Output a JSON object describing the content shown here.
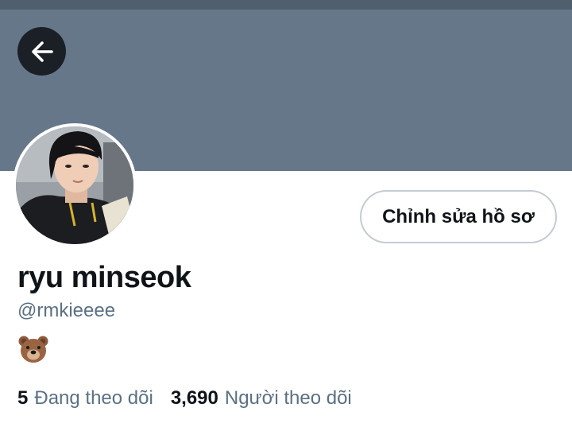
{
  "profile": {
    "edit_button_label": "Chỉnh sửa hồ sơ",
    "display_name": "ryu minseok",
    "handle": "@rmkieeee",
    "bio_icon": "bear-face-icon"
  },
  "stats": {
    "following_count": "5",
    "following_label": "Đang theo dõi",
    "followers_count": "3,690",
    "followers_label": "Người theo dõi"
  },
  "colors": {
    "banner": "#66778a",
    "back_button_bg": "#1b2026",
    "text_primary": "#0f1419",
    "text_secondary": "#5b7083",
    "button_border": "#c4ccd3"
  },
  "icons": {
    "back": "arrow-left-icon",
    "avatar": "profile-photo"
  }
}
